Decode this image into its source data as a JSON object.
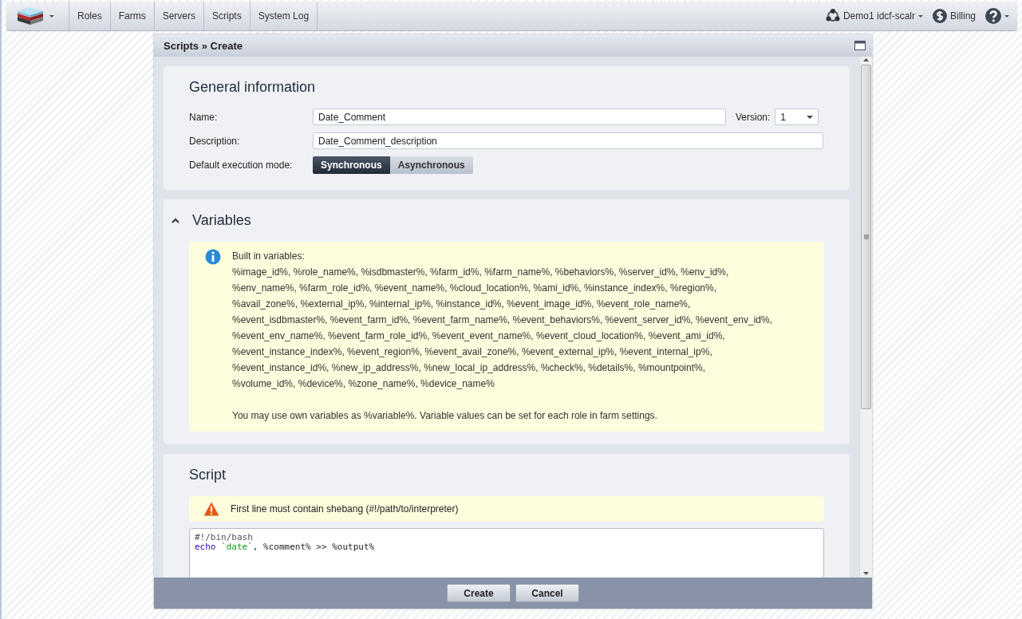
{
  "topbar": {
    "nav": [
      "Roles",
      "Farms",
      "Servers",
      "Scripts",
      "System Log"
    ],
    "environment": "Demo1 idcf-scalr",
    "billing": "Billing"
  },
  "panel": {
    "title": "Scripts » Create",
    "general": {
      "heading": "General information",
      "name_label": "Name:",
      "name_value": "Date_Comment",
      "version_label": "Version:",
      "version_value": "1",
      "description_label": "Description:",
      "description_value": "Date_Comment_description",
      "mode_label": "Default execution mode:",
      "modes": [
        {
          "label": "Synchronous",
          "selected": true
        },
        {
          "label": "Asynchronous",
          "selected": false
        }
      ]
    },
    "variables": {
      "heading": "Variables",
      "expanded": true,
      "intro": "Built in variables:",
      "lines": [
        "%image_id%, %role_name%, %isdbmaster%, %farm_id%, %farm_name%, %behaviors%, %server_id%, %env_id%,",
        "%env_name%, %farm_role_id%, %event_name%, %cloud_location%, %ami_id%, %instance_index%, %region%,",
        "%avail_zone%, %external_ip%, %internal_ip%, %instance_id%, %event_image_id%, %event_role_name%,",
        "%event_isdbmaster%, %event_farm_id%, %event_farm_name%, %event_behaviors%, %event_server_id%, %event_env_id%,",
        "%event_env_name%, %event_farm_role_id%, %event_event_name%, %event_cloud_location%, %event_ami_id%,",
        "%event_instance_index%, %event_region%, %event_avail_zone%, %event_external_ip%, %event_internal_ip%,",
        "%event_instance_id%, %new_ip_address%, %new_local_ip_address%, %check%, %details%, %mountpoint%,",
        "%volume_id%, %device%, %zone_name%, %device_name%"
      ],
      "note": "You may use own variables as %variable%. Variable values can be set for each role in farm settings."
    },
    "script": {
      "heading": "Script",
      "warning": "First line must contain shebang (#!/path/to/interpreter)",
      "code": [
        [
          {
            "text": "#!/bin/bash",
            "kind": "comment"
          }
        ],
        [
          {
            "text": "echo",
            "kind": "keyword"
          },
          {
            "text": " `date`",
            "kind": "string"
          },
          {
            "text": ", %comment% >> %output%",
            "kind": "plain"
          }
        ]
      ]
    },
    "buttons": [
      "Create",
      "Cancel"
    ]
  }
}
